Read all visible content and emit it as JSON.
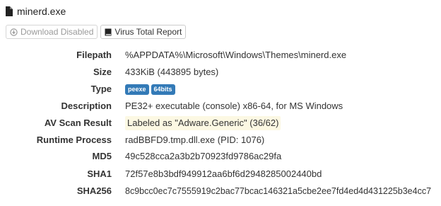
{
  "header": {
    "title": "minerd.exe",
    "icon": "file-icon"
  },
  "toolbar": {
    "download_label": "Download Disabled",
    "download_icon": "circle-down-icon",
    "virustotal_label": "Virus Total Report",
    "virustotal_icon": "book-icon"
  },
  "details": {
    "filepath": {
      "label": "Filepath",
      "value": "%APPDATA%\\Microsoft\\Windows\\Themes\\minerd.exe"
    },
    "size": {
      "label": "Size",
      "value": "433KiB (443895 bytes)"
    },
    "type": {
      "label": "Type",
      "badges": [
        "peexe",
        "64bits"
      ]
    },
    "description": {
      "label": "Description",
      "value": "PE32+ executable (console) x86-64, for MS Windows"
    },
    "av_scan": {
      "label": "AV Scan Result",
      "value": "Labeled as \"Adware.Generic\" (36/62)"
    },
    "runtime_process": {
      "label": "Runtime Process",
      "value": "radBBFD9.tmp.dll.exe (PID: 1076)"
    },
    "md5": {
      "label": "MD5",
      "value": "49c528cca2a3b2b70923fd9786ac29fa"
    },
    "sha1": {
      "label": "SHA1",
      "value": "72f57e8b3bdf949912aa6bf6d2948285002440bd"
    },
    "sha256": {
      "label": "SHA256",
      "value": "8c9bcc0ec7c7555919c2bac77bcac146321a5cbe2ee7fd4ed4d431225b3e4cc7"
    }
  },
  "colors": {
    "badge": "#337ab7",
    "warning_bg": "#fcf8e3"
  }
}
